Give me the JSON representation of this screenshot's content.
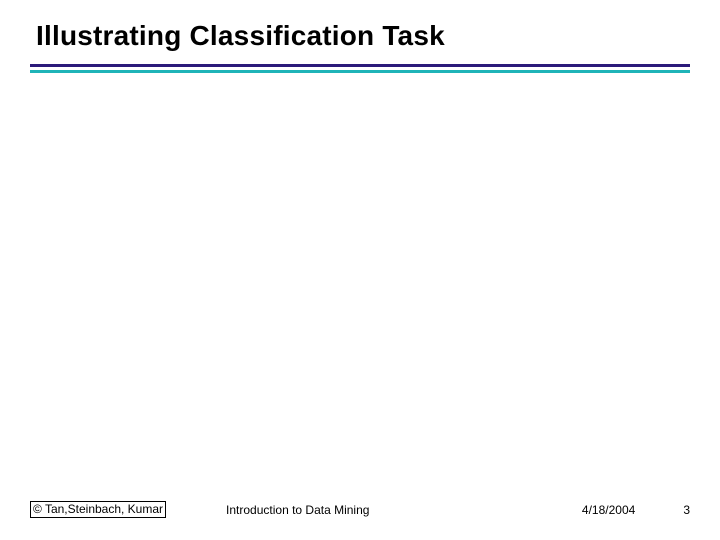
{
  "slide": {
    "title": "Illustrating Classification Task"
  },
  "footer": {
    "copyright": "© Tan,Steinbach, Kumar",
    "center": "Introduction to Data Mining",
    "date": "4/18/2004",
    "page": "3"
  }
}
